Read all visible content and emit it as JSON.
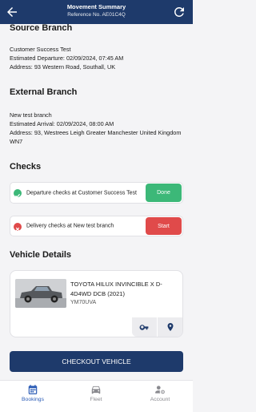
{
  "header": {
    "title": "Movement Summary",
    "reference": "Reference No. AE01C4Q"
  },
  "source_branch": {
    "title": "Source Branch",
    "name": "Customer Success Test",
    "departure": "Estimated Departure: 02/09/2024, 07:45 AM",
    "address": "Address: 93 Western Road, Southall, UK"
  },
  "external_branch": {
    "title": "External Branch",
    "name": "New test branch",
    "arrival": "Estimated Arrival: 02/09/2024, 08:00 AM",
    "address": "Address: 93, Westrees Leigh Greater Manchester United Kingdom WN7"
  },
  "checks": {
    "title": "Checks",
    "items": [
      {
        "label": "Departure checks at  Customer Success Test",
        "button": "Done",
        "status": "done"
      },
      {
        "label": "Delivery checks at  New test branch",
        "button": "Start",
        "status": "pending"
      }
    ]
  },
  "vehicle": {
    "title": "Vehicle Details",
    "name": "TOYOTA HILUX INVINCIBLE X D-4D4WD DCB (2021)",
    "registration": "YM70UVA"
  },
  "checkout_button": "CHECKOUT VEHICLE",
  "nav": {
    "items": [
      {
        "label": "Bookings",
        "icon": "calendar-icon",
        "active": true
      },
      {
        "label": "Fleet",
        "icon": "car-icon",
        "active": false
      },
      {
        "label": "Account",
        "icon": "account-icon",
        "active": false
      }
    ]
  },
  "colors": {
    "primary": "#1e3a6b",
    "done": "#3cb878",
    "start": "#e04a4a",
    "nav_active": "#2a5bb5"
  }
}
